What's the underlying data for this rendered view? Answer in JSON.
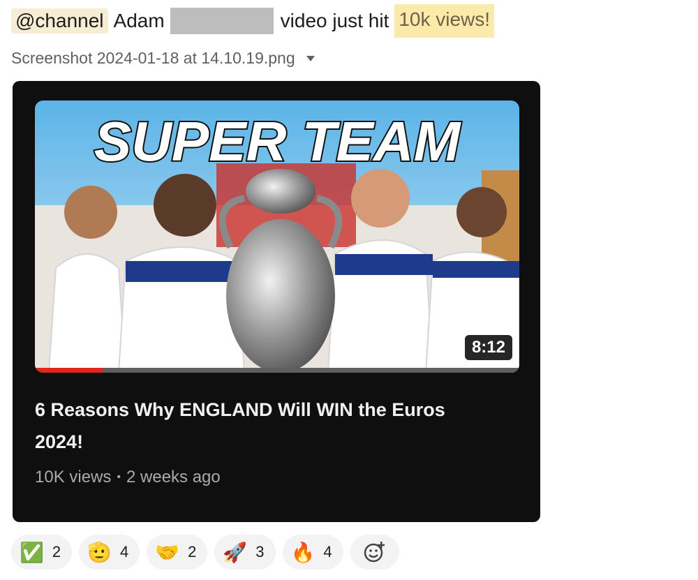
{
  "message": {
    "mention": "@channel",
    "name_part": "Adam",
    "text": "video just hit",
    "highlight": "10k views!"
  },
  "attachment": {
    "filename": "Screenshot 2024-01-18 at 14.10.19.png"
  },
  "video": {
    "thumbnail_text": "SUPER TEAM",
    "duration": "8:12",
    "progress_fraction": 0.14,
    "title": "6 Reasons Why ENGLAND Will WIN the Euros 2024!",
    "views": "10K views",
    "age": "2 weeks ago"
  },
  "reactions": [
    {
      "emoji": "✅",
      "icon": "check-mark-icon",
      "count": "2"
    },
    {
      "emoji": "🫡",
      "icon": "salute-face-icon",
      "count": "4"
    },
    {
      "emoji": "🤝",
      "icon": "handshake-icon",
      "count": "2"
    },
    {
      "emoji": "🚀",
      "icon": "rocket-icon",
      "count": "3"
    },
    {
      "emoji": "🔥",
      "icon": "fire-icon",
      "count": "4"
    }
  ],
  "add_reaction_icon": "add-reaction-icon",
  "colors": {
    "mention_bg": "#f7edd4",
    "highlight_bg": "#fbeaa9",
    "card_bg": "#0f0f0f",
    "progress": "#e1261c"
  }
}
